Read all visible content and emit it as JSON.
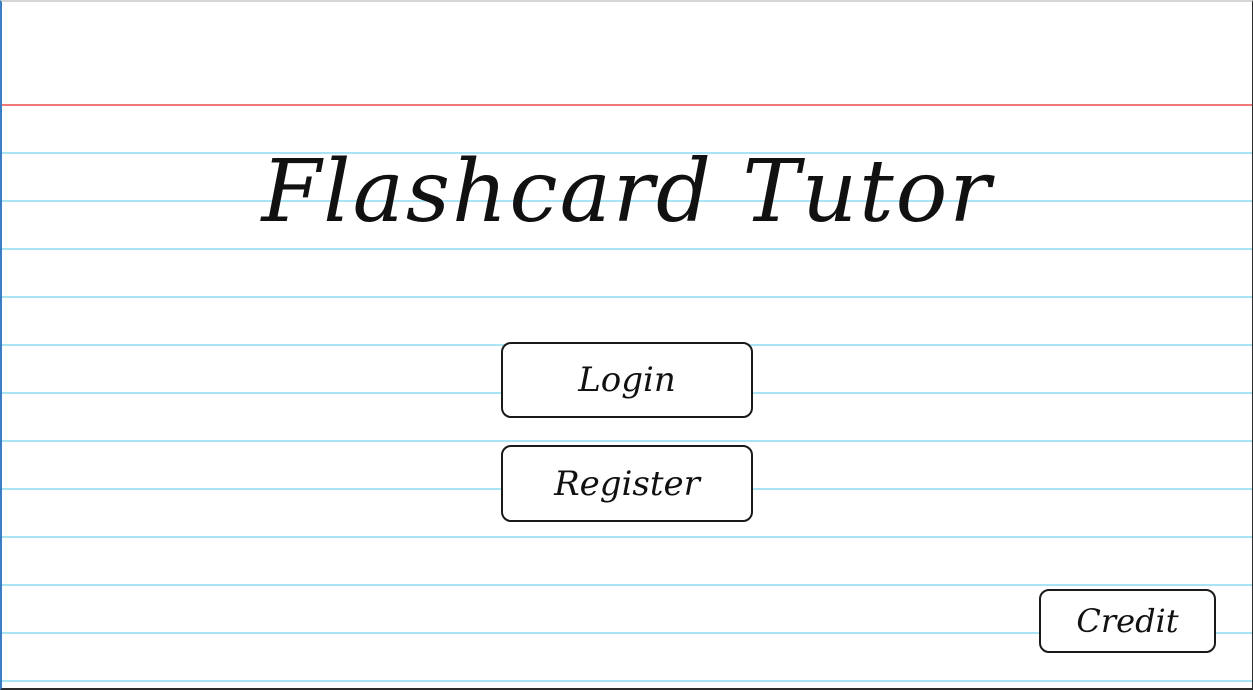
{
  "app": {
    "title": "Flashcard Tutor"
  },
  "buttons": {
    "login_label": "Login",
    "register_label": "Register",
    "credit_label": "Credit"
  },
  "colors": {
    "header_rule": "#f07878",
    "ruled_lines": "#a9e3f4",
    "button_border": "#1a1a1a",
    "background": "#ffffff"
  }
}
